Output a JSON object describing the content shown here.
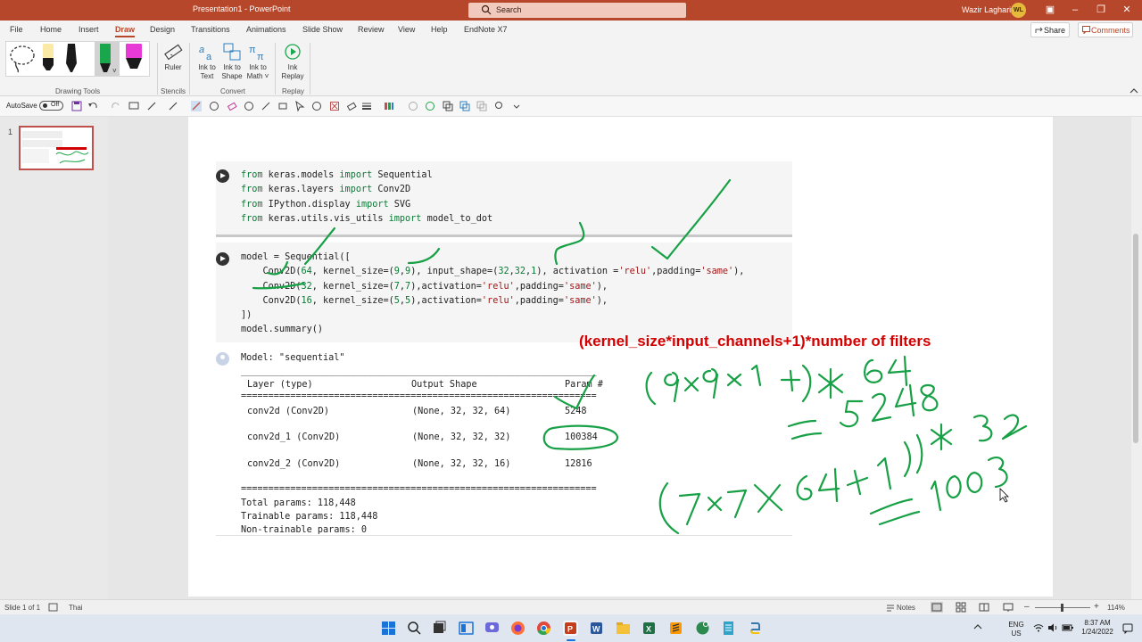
{
  "window": {
    "title": "Presentation1  -  PowerPoint",
    "search_placeholder": "Search",
    "user_name": "Wazir Laghari",
    "user_initials": "WL"
  },
  "menu": {
    "tabs": [
      "File",
      "Home",
      "Insert",
      "Draw",
      "Design",
      "Transitions",
      "Animations",
      "Slide Show",
      "Review",
      "View",
      "Help",
      "EndNote X7"
    ],
    "active_tab": "Draw",
    "share_label": "Share",
    "comments_label": "Comments"
  },
  "ribbon": {
    "groups": {
      "drawing_tools": "Drawing Tools",
      "stencils": "Stencils",
      "convert": "Convert",
      "replay": "Replay"
    },
    "ruler_label": "Ruler",
    "ink_to_text": [
      "Ink to",
      "Text"
    ],
    "ink_to_shape": [
      "Ink to",
      "Shape"
    ],
    "ink_to_math": [
      "Ink to",
      "Math ˅"
    ],
    "ink_replay": [
      "Ink",
      "Replay"
    ],
    "pen_colors": [
      "#ffe32b",
      "#1a1a1a",
      "#1aa64b",
      "#e83ad6"
    ]
  },
  "quick_toolbar": {
    "autosave_label": "AutoSave",
    "autosave_state": "Off"
  },
  "slides_pane": {
    "slide_number": "1"
  },
  "code_cells": {
    "imports": [
      [
        "from",
        " keras.models ",
        "import",
        " Sequential"
      ],
      [
        "from",
        " keras.layers ",
        "import",
        " Conv2D"
      ],
      [
        "from",
        " IPython.display ",
        "import",
        " SVG"
      ],
      [
        "from",
        " keras.utils.vis_utils ",
        "import",
        " model_to_dot"
      ]
    ],
    "model": {
      "line1": "model = Sequential([",
      "line2a": "    Conv2D(",
      "line2b": "64",
      "line2c": ", kernel_size=(",
      "line2d": "9",
      "line2e": ",",
      "line2f": "9",
      "line2g": "), input_shape=(",
      "line2h": "32",
      "line2i": ",",
      "line2j": "32",
      "line2k": ",",
      "line2l": "1",
      "line2m": "), activation =",
      "line2n": "'relu'",
      "line2o": ",padding=",
      "line2p": "'same'",
      "line2q": "),",
      "line3a": "    Conv2D(",
      "line3b": "32",
      "line3c": ", kernel_size=(",
      "line3d": "7",
      "line3e": ",",
      "line3f": "7",
      "line3g": "),activation=",
      "line3h": "'relu'",
      "line3i": ",padding=",
      "line3j": "'same'",
      "line3k": "),",
      "line4a": "    Conv2D(",
      "line4b": "16",
      "line4c": ", kernel_size=(",
      "line4d": "5",
      "line4e": ",",
      "line4f": "5",
      "line4g": "),activation=",
      "line4h": "'relu'",
      "line4i": ",padding=",
      "line4j": "'same'",
      "line4k": "),",
      "line5": "])",
      "line6": "model.summary()"
    }
  },
  "summary": {
    "model_line": "Model: \"sequential\"",
    "rule_single": "_________________________________________________________________",
    "rule_double": "=================================================================",
    "headers": [
      "Layer (type)",
      "Output Shape",
      "Param #"
    ],
    "rows": [
      [
        "conv2d (Conv2D)",
        "(None, 32, 32, 64)",
        "5248"
      ],
      [
        "conv2d_1 (Conv2D)",
        "(None, 32, 32, 32)",
        "100384"
      ],
      [
        "conv2d_2 (Conv2D)",
        "(None, 32, 32, 16)",
        "12816"
      ]
    ],
    "total_params": "Total params: 118,448",
    "trainable_params": "Trainable params: 118,448",
    "non_trainable_params": "Non-trainable params: 0"
  },
  "annotation": {
    "formula": "(kernel_size*input_channels+1)*number of filters"
  },
  "status_bar": {
    "slide_info": "Slide 1 of 1",
    "language": "Thai",
    "notes_label": "Notes",
    "zoom": "114%"
  },
  "taskbar": {
    "lang_top": "ENG",
    "lang_bottom": "US",
    "time": "8:37 AM",
    "date": "1/24/2022"
  }
}
